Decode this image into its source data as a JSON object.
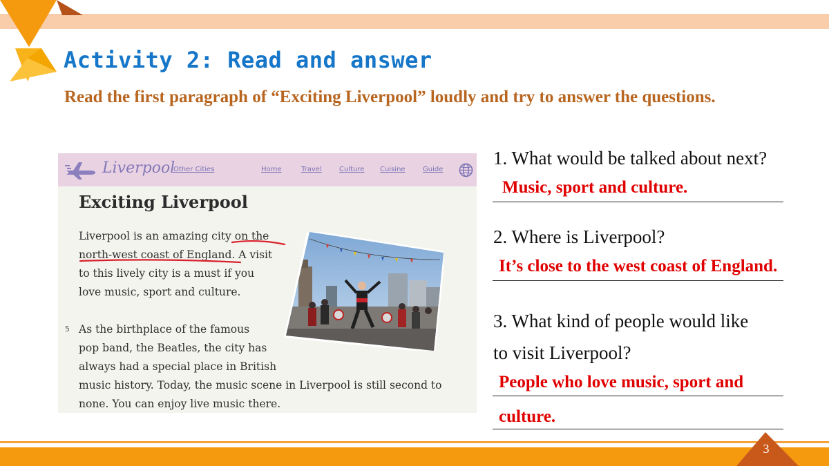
{
  "slide": {
    "title": "Activity 2: Read and answer",
    "instruction": "Read the first paragraph of “Exciting Liverpool” loudly and try to answer the questions.",
    "page_number": "3"
  },
  "textbook": {
    "brand": "Liverpool",
    "nav": [
      "Other Cities",
      "Home",
      "Travel",
      "Culture",
      "Cuisine",
      "Guide"
    ],
    "heading": "Exciting Liverpool",
    "paragraph1": [
      "Liverpool is an amazing city on the",
      "north-west coast of England. A visit",
      "to this lively city is a must if you",
      "love music, sport and culture."
    ],
    "line_number": "5",
    "paragraph2": [
      "As the birthplace of the famous",
      "pop band, the Beatles, the city has",
      "always had a special place in British",
      "music history. Today, the music scene in Liverpool is still second to",
      "none. You can enjoy live music there."
    ]
  },
  "questions": [
    {
      "lines": [
        "1. What would be talked about next?"
      ],
      "answer": [
        "Music, sport and culture."
      ]
    },
    {
      "lines": [
        "2. Where is Liverpool?"
      ],
      "answer": [
        "It’s close to the west coast of England."
      ]
    },
    {
      "lines": [
        "3. What kind of people would like",
        "to visit Liverpool?"
      ],
      "answer": [
        "People who love music, sport and",
        "culture."
      ]
    }
  ],
  "colors": {
    "title": "#1677c9",
    "instruction": "#b8651f",
    "answer": "#e00000",
    "accent_orange": "#f59a0f"
  },
  "icons": [
    "triangle-decoration",
    "airplane-icon",
    "globe-icon",
    "page-badge-triangle"
  ]
}
